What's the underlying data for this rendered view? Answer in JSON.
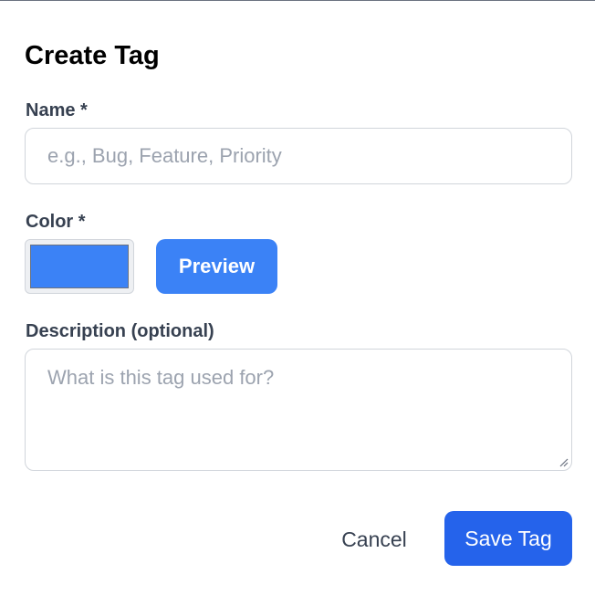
{
  "dialog": {
    "title": "Create Tag"
  },
  "form": {
    "name": {
      "label": "Name *",
      "value": "",
      "placeholder": "e.g., Bug, Feature, Priority"
    },
    "color": {
      "label": "Color *",
      "value": "#3b82f6",
      "preview_label": "Preview",
      "preview_text_color": "#ffffff"
    },
    "description": {
      "label": "Description (optional)",
      "value": "",
      "placeholder": "What is this tag used for?"
    }
  },
  "actions": {
    "cancel_label": "Cancel",
    "save_label": "Save Tag",
    "save_color": "#2563eb"
  },
  "icons": {
    "resize_handle": "resize-handle-icon"
  }
}
